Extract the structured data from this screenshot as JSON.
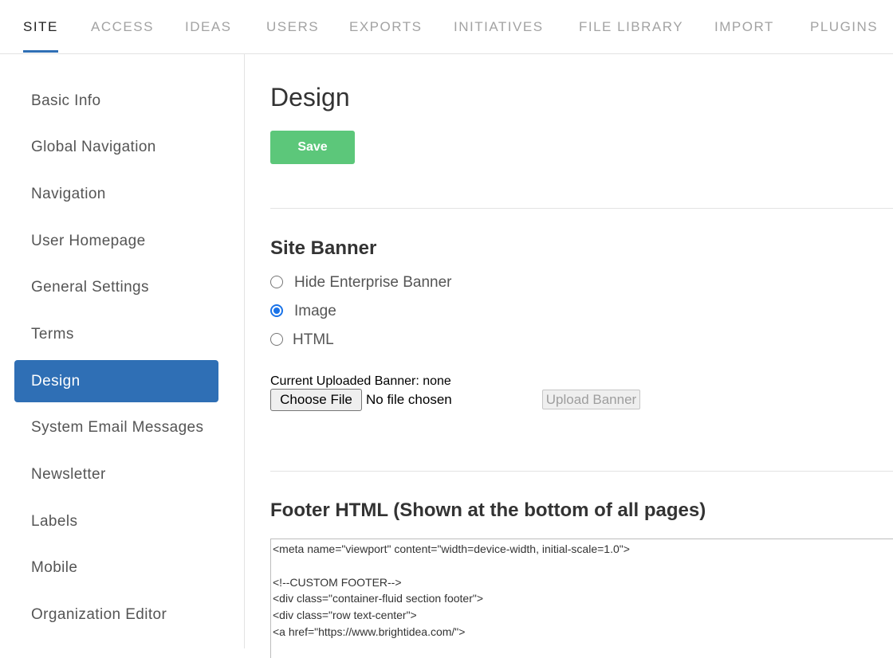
{
  "topnav": {
    "tabs": [
      {
        "label": "SITE",
        "active": true
      },
      {
        "label": "ACCESS"
      },
      {
        "label": "IDEAS"
      },
      {
        "label": "USERS"
      },
      {
        "label": "EXPORTS"
      },
      {
        "label": "INITIATIVES"
      },
      {
        "label": "FILE LIBRARY"
      },
      {
        "label": "IMPORT"
      },
      {
        "label": "PLUGINS"
      }
    ]
  },
  "sidebar": {
    "items": [
      {
        "label": "Basic Info"
      },
      {
        "label": "Global Navigation"
      },
      {
        "label": "Navigation"
      },
      {
        "label": "User Homepage"
      },
      {
        "label": "General Settings"
      },
      {
        "label": "Terms"
      },
      {
        "label": "Design",
        "active": true
      },
      {
        "label": "System Email Messages"
      },
      {
        "label": "Newsletter"
      },
      {
        "label": "Labels"
      },
      {
        "label": "Mobile"
      },
      {
        "label": "Organization Editor"
      }
    ]
  },
  "main": {
    "title": "Design",
    "save_label": "Save",
    "site_banner": {
      "title": "Site Banner",
      "options": [
        {
          "label": "Hide Enterprise Banner",
          "checked": false
        },
        {
          "label": "Image",
          "checked": true
        },
        {
          "label": "HTML",
          "checked": false
        }
      ],
      "current_banner": "Current Uploaded Banner: none",
      "choose_file_label": "Choose File",
      "no_file_text": "No file chosen",
      "upload_label": "Upload Banner"
    },
    "footer": {
      "title": "Footer HTML (Shown at the bottom of all pages)",
      "code": "<meta name=\"viewport\" content=\"width=device-width, initial-scale=1.0\">\n\n<!--CUSTOM FOOTER-->\n<div class=\"container-fluid section footer\">\n<div class=\"row text-center\">\n<a href=\"https://www.brightidea.com/\">"
    }
  },
  "colors": {
    "accent": "#2f6fb5",
    "save": "#5cc77a",
    "radio_checked": "#1a73e8"
  }
}
